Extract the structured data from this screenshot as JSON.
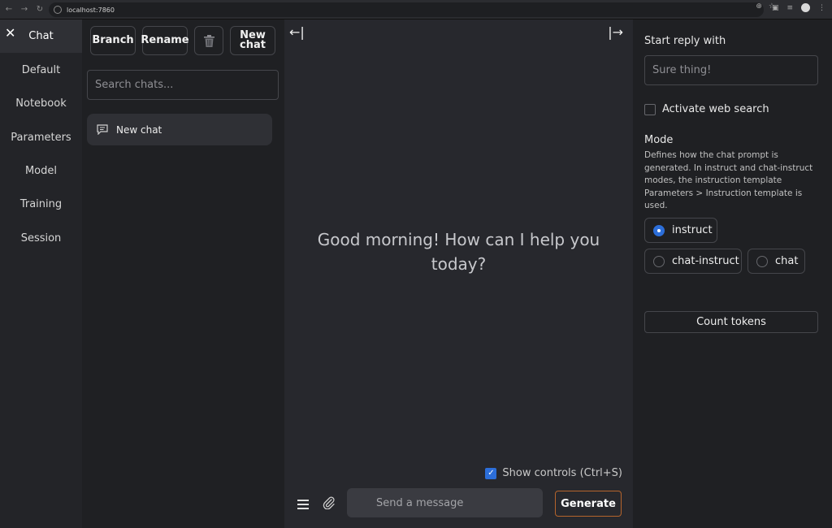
{
  "browser": {
    "url": "localhost:7860"
  },
  "nav": {
    "items": [
      {
        "label": "Chat"
      },
      {
        "label": "Default"
      },
      {
        "label": "Notebook"
      },
      {
        "label": "Parameters"
      },
      {
        "label": "Model"
      },
      {
        "label": "Training"
      },
      {
        "label": "Session"
      }
    ],
    "active": "Chat"
  },
  "chat_list": {
    "branch_label": "Branch",
    "rename_label": "Rename",
    "new_chat_label": "New chat",
    "search_placeholder": "Search chats...",
    "chats": [
      {
        "title": "New chat"
      }
    ]
  },
  "main": {
    "greeting": "Good morning! How can I help you today?",
    "show_controls_label": "Show controls (Ctrl+S)",
    "show_controls_checked": true,
    "message_placeholder": "Send a message",
    "generate_label": "Generate"
  },
  "right": {
    "start_reply_label": "Start reply with",
    "start_reply_placeholder": "Sure thing!",
    "web_search_label": "Activate web search",
    "mode_label": "Mode",
    "mode_description": "Defines how the chat prompt is generated. In instruct and chat-instruct modes, the instruction template Parameters > Instruction template is used.",
    "modes": [
      {
        "label": "instruct",
        "selected": true
      },
      {
        "label": "chat-instruct",
        "selected": false
      },
      {
        "label": "chat",
        "selected": false
      }
    ],
    "count_tokens_label": "Count tokens"
  },
  "colors": {
    "accent": "#2c6ed9",
    "generate_border": "#b5642c"
  }
}
